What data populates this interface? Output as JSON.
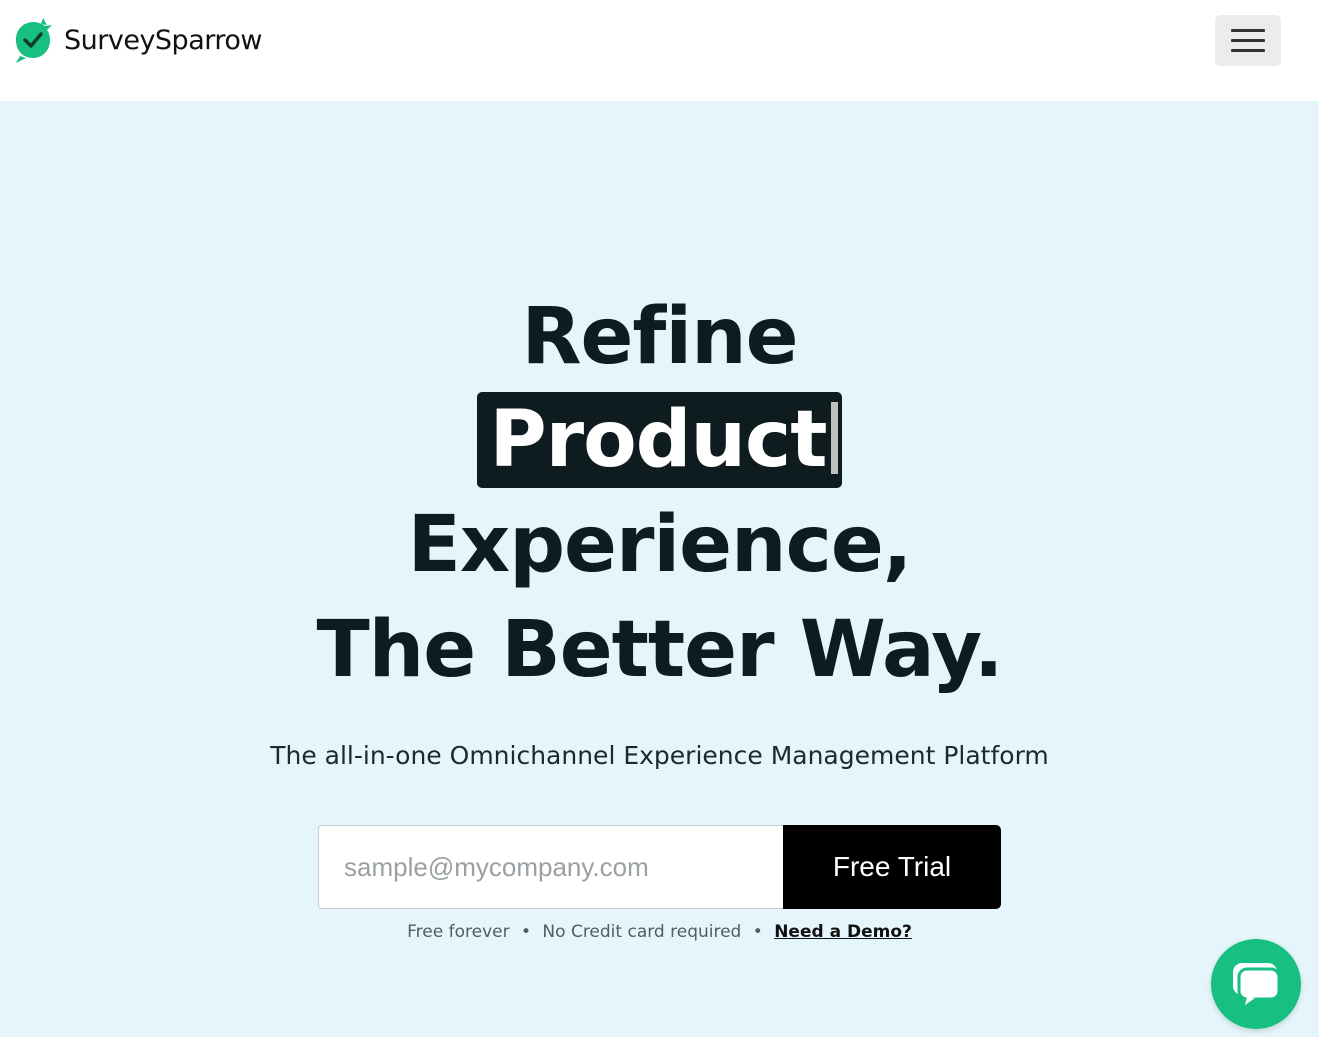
{
  "header": {
    "brand_name": "SurveySparrow",
    "brand_color": "#17c082",
    "menu_icon": "hamburger-icon"
  },
  "hero": {
    "headline": {
      "line1": "Refine",
      "line2_highlight": "Product",
      "line3": "Experience,",
      "line4": "The Better Way."
    },
    "subtitle": "The all-in-one Omnichannel Experience Management Platform",
    "signup": {
      "email_placeholder": "sample@mycompany.com",
      "email_value": "",
      "button_label": "Free Trial"
    },
    "note": {
      "part1": "Free forever",
      "separator": "•",
      "part2": "No Credit card required",
      "demo_link": "Need a Demo?"
    }
  },
  "chat": {
    "icon": "chat-bubble-icon",
    "color": "#17c082"
  },
  "colors": {
    "hero_background": "#e4f6fb",
    "headline": "#0f1c1f",
    "button_background": "#000000"
  }
}
